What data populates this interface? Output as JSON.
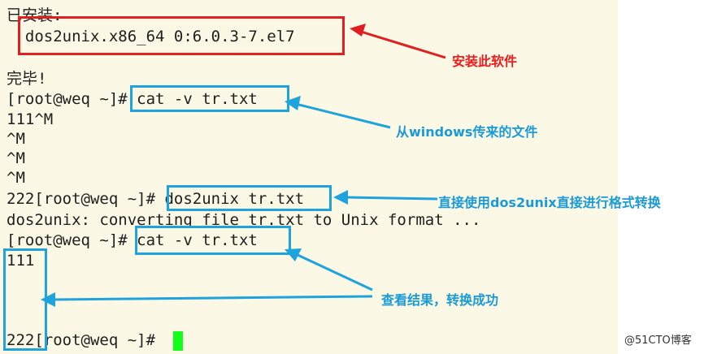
{
  "terminal": {
    "lines": [
      "已安装:",
      "  dos2unix.x86_64 0:6.0.3-7.el7",
      "",
      "完毕!",
      "[root@weq ~]# cat -v tr.txt",
      "111^M",
      "^M",
      "^M",
      "^M",
      "222[root@weq ~]# dos2unix tr.txt",
      "dos2unix: converting file tr.txt to Unix format ...",
      "[root@weq ~]# cat -v tr.txt",
      "111",
      "",
      "",
      "222[root@weq ~]# "
    ],
    "cursor_color": "#13ff1a"
  },
  "annotations": {
    "install": "安装此软件",
    "from_windows": "从windows传来的文件",
    "convert": "直接使用dos2unix直接进行格式转换",
    "result": "查看结果，转换成功"
  },
  "colors": {
    "terminal_bg": "#fbf8e6",
    "annotation_red": "#ee1c1c",
    "annotation_blue": "#1a9ad6",
    "box_red": "#e02020",
    "box_blue": "#1ea3dc",
    "cursor": "#13ff1a"
  },
  "watermark": "@51CTO博客"
}
